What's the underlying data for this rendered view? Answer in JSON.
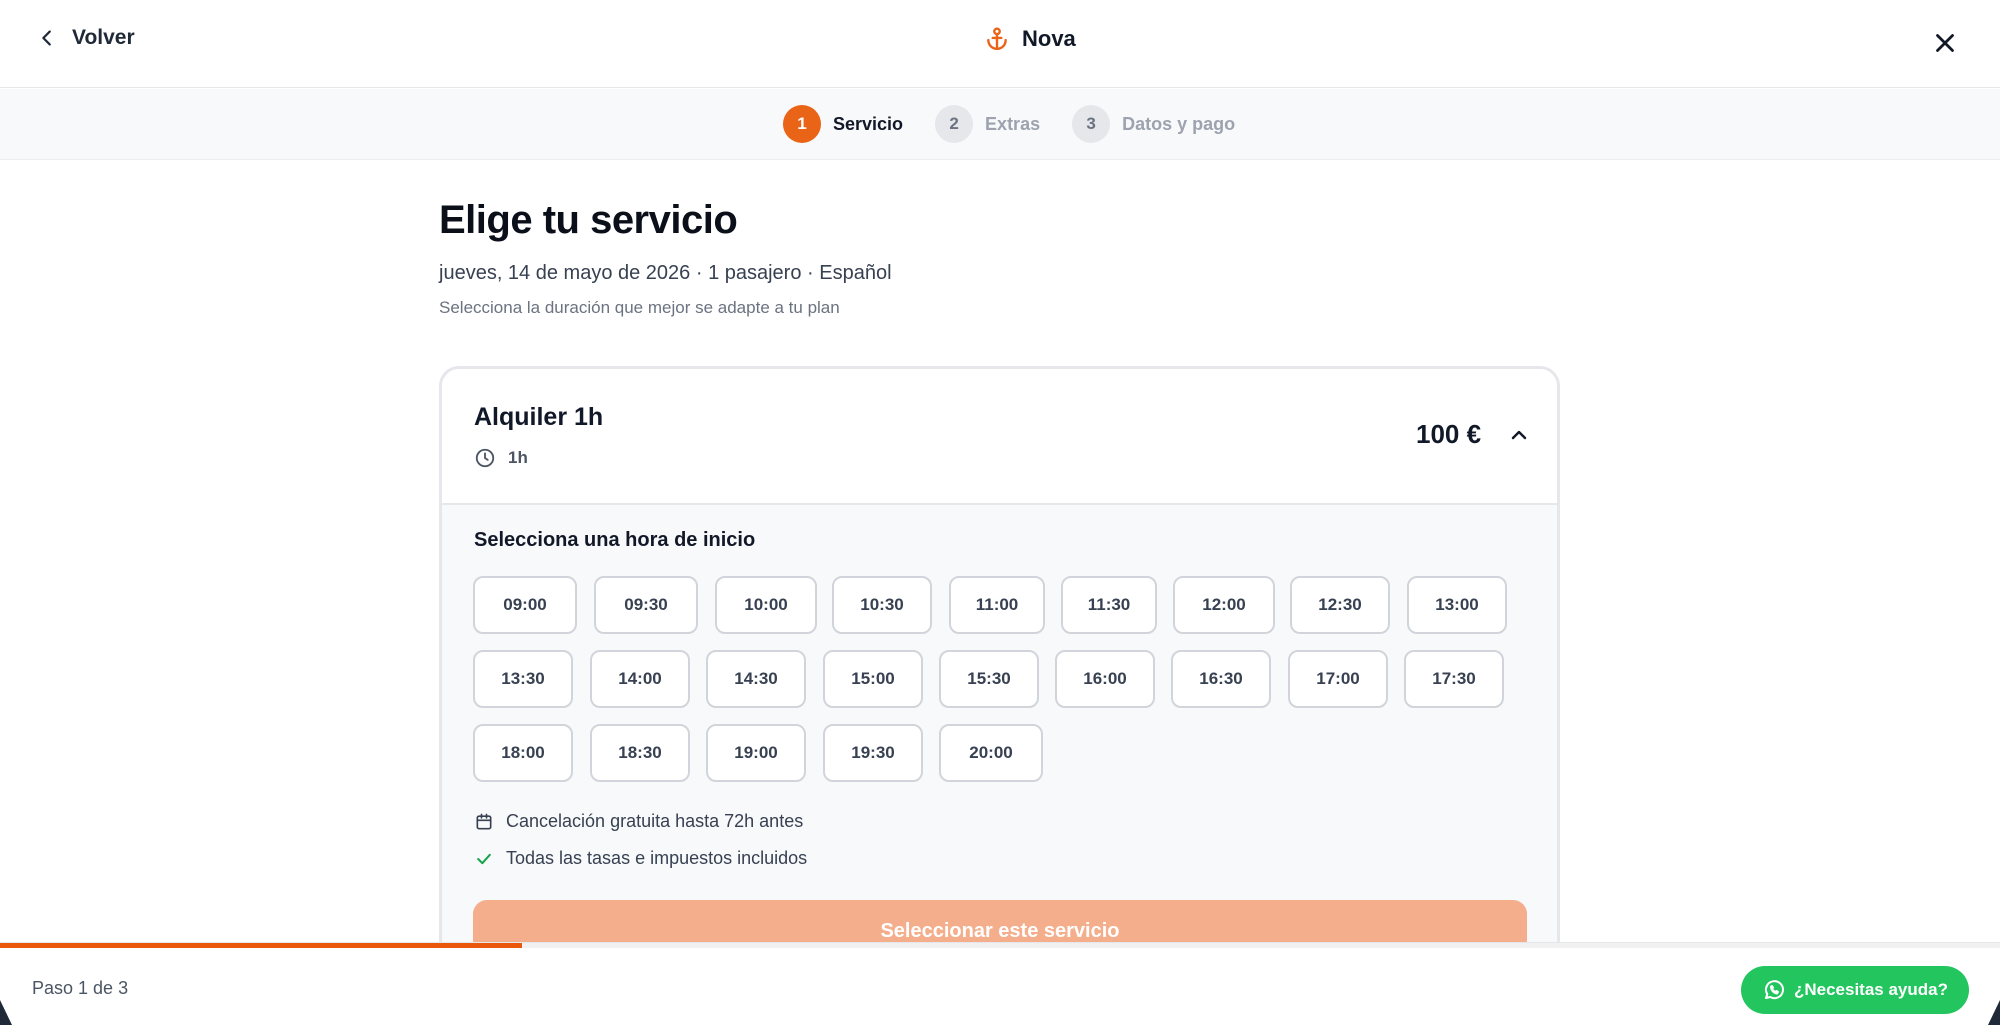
{
  "header": {
    "back_label": "Volver",
    "brand_name": "Nova",
    "brand_icon": "anchor-icon",
    "close_icon": "close-icon"
  },
  "stepper": {
    "steps": [
      {
        "number": "1",
        "label": "Servicio",
        "state": "active"
      },
      {
        "number": "2",
        "label": "Extras",
        "state": "pending"
      },
      {
        "number": "3",
        "label": "Datos y pago",
        "state": "pending"
      }
    ]
  },
  "page": {
    "title": "Elige tu servicio",
    "meta": "jueves, 14 de mayo de 2026 · 1 pasajero · Español",
    "hint": "Selecciona la duración que mejor se adapte a tu plan"
  },
  "service": {
    "name": "Alquiler 1h",
    "duration": "1h",
    "price": "100 €",
    "expanded": true,
    "slots_label": "Selecciona una hora de inicio",
    "slots": [
      [
        "09:00",
        "09:30",
        "10:00",
        "10:30",
        "11:00",
        "11:30",
        "12:00",
        "12:30",
        "13:00"
      ],
      [
        "13:30",
        "14:00",
        "14:30",
        "15:00",
        "15:30",
        "16:00",
        "16:30",
        "17:00",
        "17:30"
      ],
      [
        "18:00",
        "18:30",
        "19:00",
        "19:30",
        "20:00"
      ]
    ],
    "perks": [
      {
        "icon": "calendar-icon",
        "text": "Cancelación gratuita hasta 72h antes"
      },
      {
        "icon": "check-icon",
        "text": "Todas las tasas e impuestos incluidos"
      }
    ],
    "cta_label": "Seleccionar este servicio"
  },
  "footer": {
    "step_count": "Paso 1 de 3",
    "progress": 0.333,
    "help_label": "¿Necesitas ayuda?",
    "help_icon": "whatsapp-icon"
  },
  "colors": {
    "accent": "#ea6417",
    "cta_disabled": "#f4ae8c",
    "help": "#22c55e"
  }
}
